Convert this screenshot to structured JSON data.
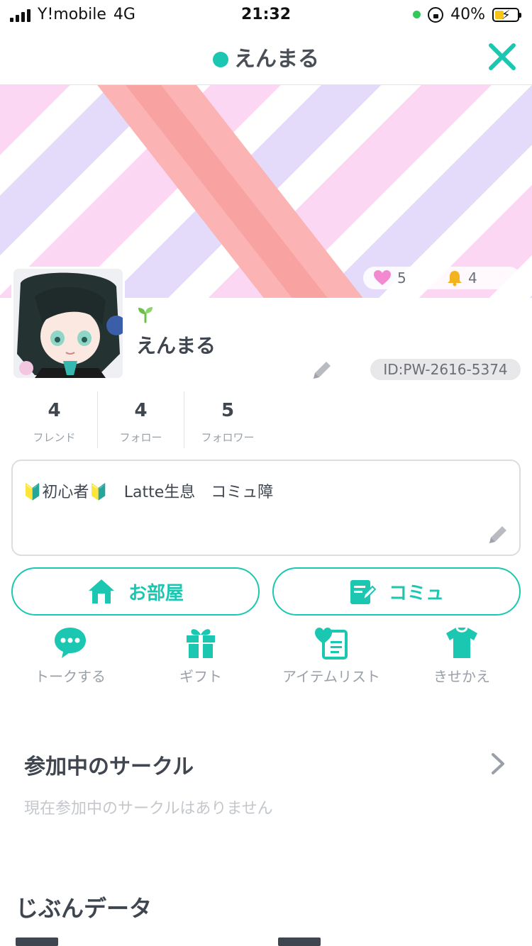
{
  "status_bar": {
    "carrier": "Y!mobile",
    "network": "4G",
    "time": "21:32",
    "battery_percent": "40%",
    "battery_level": 0.4,
    "battery_color": "#f5c518"
  },
  "header": {
    "title": "えんまる",
    "online_color": "#1cc7b2",
    "close_icon": "close-icon"
  },
  "profile": {
    "name": "えんまる",
    "id": "ID:PW-2616-5374",
    "likes": "5",
    "notifications": "4",
    "badge_icon": "sprout-icon"
  },
  "counts": [
    {
      "value": "4",
      "label": "フレンド"
    },
    {
      "value": "4",
      "label": "フォロー"
    },
    {
      "value": "5",
      "label": "フォロワー"
    }
  ],
  "bio": {
    "text": "🔰初心者🔰　Latte生息　コミュ障"
  },
  "actions": {
    "room_label": "お部屋",
    "community_label": "コミュ"
  },
  "quick_menu": [
    {
      "label": "トークする",
      "icon": "chat-bubble-icon"
    },
    {
      "label": "ギフト",
      "icon": "gift-icon"
    },
    {
      "label": "アイテムリスト",
      "icon": "heart-list-icon"
    },
    {
      "label": "きせかえ",
      "icon": "tshirt-icon"
    }
  ],
  "circles": {
    "title": "参加中のサークル",
    "empty_text": "現在参加中のサークルはありません"
  },
  "my_data": {
    "title": "じぶんデータ"
  },
  "colors": {
    "accent": "#1cc7b2",
    "text": "#3f4650",
    "muted": "#9aa0a8"
  }
}
